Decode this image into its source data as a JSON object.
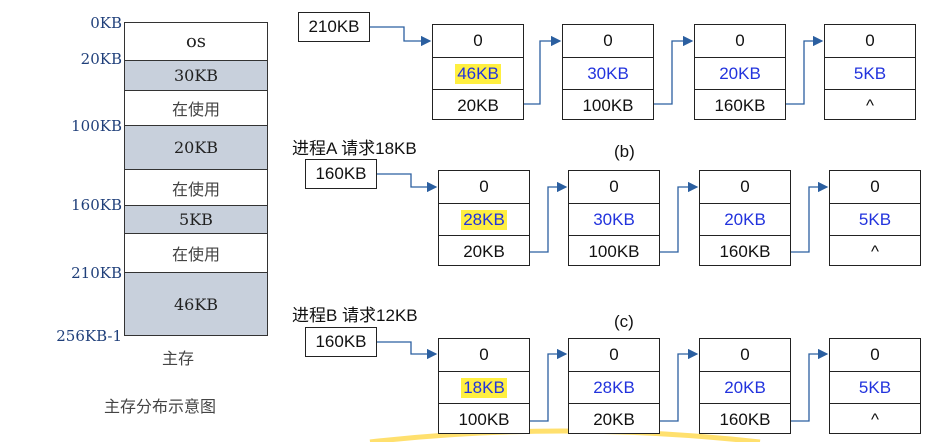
{
  "memory_map": {
    "addresses": [
      "0KB",
      "20KB",
      "100KB",
      "160KB",
      "210KB",
      "256KB-1"
    ],
    "segments": [
      "os",
      "30KB",
      "在使用",
      "20KB",
      "在使用",
      "5KB",
      "在使用",
      "46KB"
    ],
    "caption_short": "主存",
    "caption_long": "主存分布示意图"
  },
  "rows": [
    {
      "head": "210KB",
      "label": "",
      "nodes": [
        {
          "top": "0",
          "size": "46KB",
          "highlight": true,
          "bottom": "20KB"
        },
        {
          "top": "0",
          "size": "30KB",
          "highlight": false,
          "bottom": "100KB"
        },
        {
          "top": "0",
          "size": "20KB",
          "highlight": false,
          "bottom": "160KB"
        },
        {
          "top": "0",
          "size": "5KB",
          "highlight": false,
          "bottom": "^"
        }
      ]
    },
    {
      "head": "160KB",
      "label": "进程A 请求18KB",
      "nodes": [
        {
          "top": "0",
          "size": "28KB",
          "highlight": true,
          "bottom": "20KB"
        },
        {
          "top": "0",
          "size": "30KB",
          "highlight": false,
          "bottom": "100KB"
        },
        {
          "top": "0",
          "size": "20KB",
          "highlight": false,
          "bottom": "160KB"
        },
        {
          "top": "0",
          "size": "5KB",
          "highlight": false,
          "bottom": "^"
        }
      ]
    },
    {
      "head": "160KB",
      "label": "进程B 请求12KB",
      "nodes": [
        {
          "top": "0",
          "size": "18KB",
          "highlight": true,
          "bottom": "100KB"
        },
        {
          "top": "0",
          "size": "28KB",
          "highlight": false,
          "bottom": "20KB"
        },
        {
          "top": "0",
          "size": "20KB",
          "highlight": false,
          "bottom": "160KB"
        },
        {
          "top": "0",
          "size": "5KB",
          "highlight": false,
          "bottom": "^"
        }
      ]
    }
  ],
  "subfigure_labels": [
    "(b)",
    "(c)"
  ]
}
